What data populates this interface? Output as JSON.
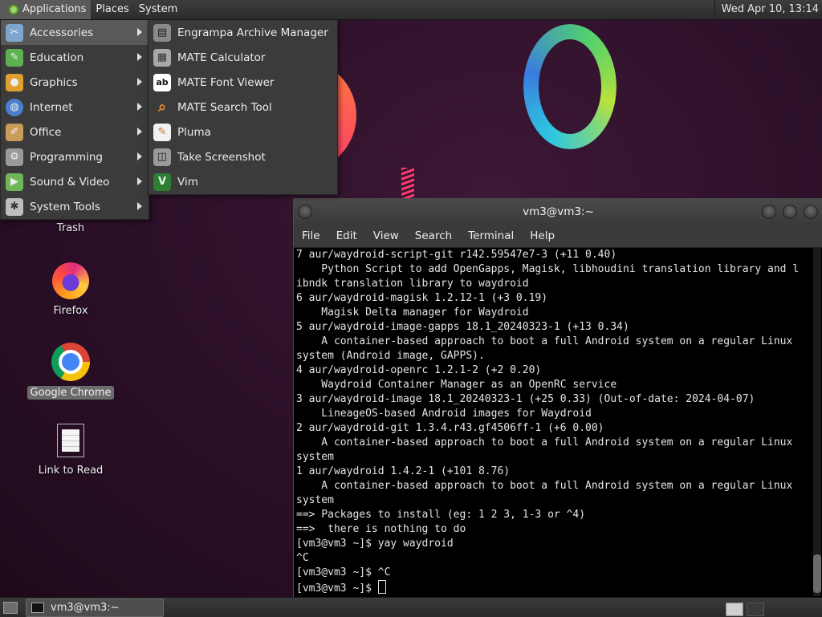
{
  "top_panel": {
    "menus": [
      {
        "label": "Applications"
      },
      {
        "label": "Places"
      },
      {
        "label": "System"
      }
    ],
    "clock": "Wed Apr 10, 13:14"
  },
  "apps_menu": {
    "categories": [
      {
        "label": "Accessories",
        "icon": "accessories-icon",
        "color": "#7da6cf"
      },
      {
        "label": "Education",
        "icon": "education-icon",
        "color": "#5bb24e"
      },
      {
        "label": "Graphics",
        "icon": "graphics-icon",
        "color": "#e0a030"
      },
      {
        "label": "Internet",
        "icon": "internet-icon",
        "color": "#4a7fd0"
      },
      {
        "label": "Office",
        "icon": "office-icon",
        "color": "#c99c5a"
      },
      {
        "label": "Programming",
        "icon": "programming-icon",
        "color": "#9a9a9a"
      },
      {
        "label": "Sound & Video",
        "icon": "sound-video-icon",
        "color": "#6fb65a"
      },
      {
        "label": "System Tools",
        "icon": "system-tools-icon",
        "color": "#bdbdbd"
      }
    ],
    "accessories": [
      {
        "label": "Engrampa Archive Manager",
        "icon": "archive-manager-icon",
        "glyph": "▤"
      },
      {
        "label": "MATE Calculator",
        "icon": "calculator-icon",
        "glyph": "▦"
      },
      {
        "label": "MATE Font Viewer",
        "icon": "font-viewer-icon",
        "glyph": "ab"
      },
      {
        "label": "MATE Search Tool",
        "icon": "search-tool-icon",
        "glyph": "⌕"
      },
      {
        "label": "Pluma",
        "icon": "pluma-icon",
        "glyph": "✎"
      },
      {
        "label": "Take Screenshot",
        "icon": "screenshot-icon",
        "glyph": "◫"
      },
      {
        "label": "Vim",
        "icon": "vim-icon",
        "glyph": "V"
      }
    ]
  },
  "desktop_icons": [
    {
      "label": "Trash"
    },
    {
      "label": "Firefox"
    },
    {
      "label": "Google Chrome"
    },
    {
      "label": "Link to Read"
    }
  ],
  "terminal": {
    "title": "vm3@vm3:~",
    "menu": [
      {
        "label": "File"
      },
      {
        "label": "Edit"
      },
      {
        "label": "View"
      },
      {
        "label": "Search"
      },
      {
        "label": "Terminal"
      },
      {
        "label": "Help"
      }
    ],
    "lines": [
      "7 aur/waydroid-script-git r142.59547e7-3 (+11 0.40)",
      "    Python Script to add OpenGapps, Magisk, libhoudini translation library and l",
      "ibndk translation library to waydroid",
      "6 aur/waydroid-magisk 1.2.12-1 (+3 0.19)",
      "    Magisk Delta manager for Waydroid",
      "5 aur/waydroid-image-gapps 18.1_20240323-1 (+13 0.34)",
      "    A container-based approach to boot a full Android system on a regular Linux",
      "system (Android image, GAPPS).",
      "4 aur/waydroid-openrc 1.2.1-2 (+2 0.20)",
      "    Waydroid Container Manager as an OpenRC service",
      "3 aur/waydroid-image 18.1_20240323-1 (+25 0.33) (Out-of-date: 2024-04-07)",
      "    LineageOS-based Android images for Waydroid",
      "2 aur/waydroid-git 1.3.4.r43.gf4506ff-1 (+6 0.00)",
      "    A container-based approach to boot a full Android system on a regular Linux",
      "system",
      "1 aur/waydroid 1.4.2-1 (+101 8.76)",
      "    A container-based approach to boot a full Android system on a regular Linux",
      "system",
      "==> Packages to install (eg: 1 2 3, 1-3 or ^4)",
      "==>  there is nothing to do",
      "[vm3@vm3 ~]$ yay waydroid",
      "^C",
      "[vm3@vm3 ~]$ ^C"
    ],
    "prompt": "[vm3@vm3 ~]$ "
  },
  "taskbar": {
    "task_label": "vm3@vm3:~"
  }
}
